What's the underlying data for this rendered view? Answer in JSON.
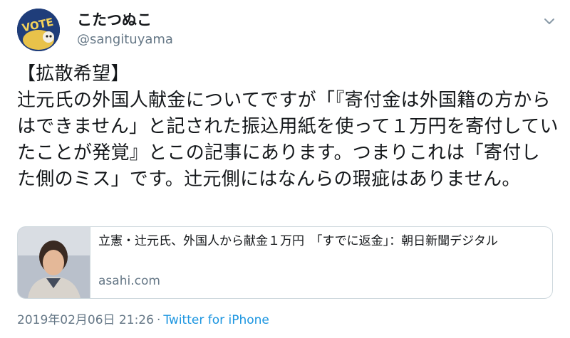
{
  "user": {
    "display_name": "こたつぬこ",
    "handle": "@sangituyama",
    "avatar_text": "VOTE"
  },
  "tweet": {
    "text": "【拡散希望】\n辻元氏の外国人献金についてですが「『寄付金は外国籍の方からはできません」と記された振込用紙を使って１万円を寄付していたことが発覚』とこの記事にあります。つまりこれは「寄付した側のミス」です。辻元側にはなんらの瑕疵はありません。"
  },
  "card": {
    "title": "立憲・辻元氏、外国人から献金１万円　「すでに返金」：朝日新聞デジタル",
    "domain": "asahi.com"
  },
  "footer": {
    "timestamp": "2019年02月06日 21:26",
    "separator": "·",
    "source": "Twitter for iPhone"
  },
  "colors": {
    "text": "#14171a",
    "muted": "#657786",
    "link": "#1b95e0",
    "border": "#cfd9de"
  },
  "icons": {
    "menu": "chevron-down-icon",
    "avatar": "avatar"
  }
}
